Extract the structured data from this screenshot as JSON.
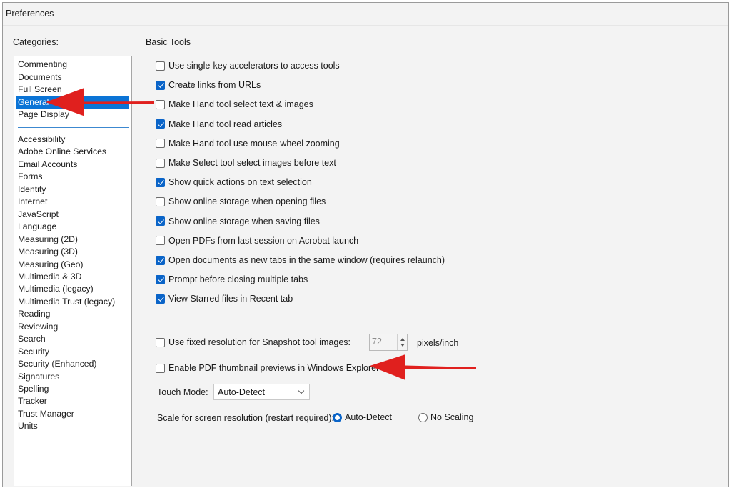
{
  "window": {
    "title": "Preferences"
  },
  "categories": {
    "label": "Categories:",
    "top_items": [
      {
        "label": "Commenting",
        "selected": false
      },
      {
        "label": "Documents",
        "selected": false
      },
      {
        "label": "Full Screen",
        "selected": false
      },
      {
        "label": "General",
        "selected": true
      },
      {
        "label": "Page Display",
        "selected": false
      }
    ],
    "items": [
      "Accessibility",
      "Adobe Online Services",
      "Email Accounts",
      "Forms",
      "Identity",
      "Internet",
      "JavaScript",
      "Language",
      "Measuring (2D)",
      "Measuring (3D)",
      "Measuring (Geo)",
      "Multimedia & 3D",
      "Multimedia (legacy)",
      "Multimedia Trust (legacy)",
      "Reading",
      "Reviewing",
      "Search",
      "Security",
      "Security (Enhanced)",
      "Signatures",
      "Spelling",
      "Tracker",
      "Trust Manager",
      "Units"
    ]
  },
  "basic_tools": {
    "label": "Basic Tools",
    "options": [
      {
        "label": "Use single-key accelerators to access tools",
        "checked": false
      },
      {
        "label": "Create links from URLs",
        "checked": true
      },
      {
        "label": "Make Hand tool select text & images",
        "checked": false
      },
      {
        "label": "Make Hand tool read articles",
        "checked": true
      },
      {
        "label": "Make Hand tool use mouse-wheel zooming",
        "checked": false
      },
      {
        "label": "Make Select tool select images before text",
        "checked": false
      },
      {
        "label": "Show quick actions on text selection",
        "checked": true
      },
      {
        "label": "Show online storage when opening files",
        "checked": false
      },
      {
        "label": "Show online storage when saving files",
        "checked": true
      },
      {
        "label": "Open PDFs from last session on Acrobat launch",
        "checked": false
      },
      {
        "label": "Open documents as new tabs in the same window (requires relaunch)",
        "checked": true
      },
      {
        "label": "Prompt before closing multiple tabs",
        "checked": true
      },
      {
        "label": "View Starred files in Recent tab",
        "checked": true
      }
    ]
  },
  "snapshot": {
    "label": "Use fixed resolution for Snapshot tool images:",
    "checked": false,
    "value": "72",
    "unit": "pixels/inch"
  },
  "thumbnail": {
    "label": "Enable PDF thumbnail previews in Windows Explorer",
    "checked": false
  },
  "touch_mode": {
    "label": "Touch Mode:",
    "value": "Auto-Detect"
  },
  "scale": {
    "label": "Scale for screen resolution (restart required):",
    "options": [
      {
        "label": "Auto-Detect",
        "selected": true
      },
      {
        "label": "No Scaling",
        "selected": false
      }
    ]
  },
  "colors": {
    "accent": "#0a64c8",
    "selection": "#0b74d6",
    "annotation_arrow": "#e0201e"
  }
}
